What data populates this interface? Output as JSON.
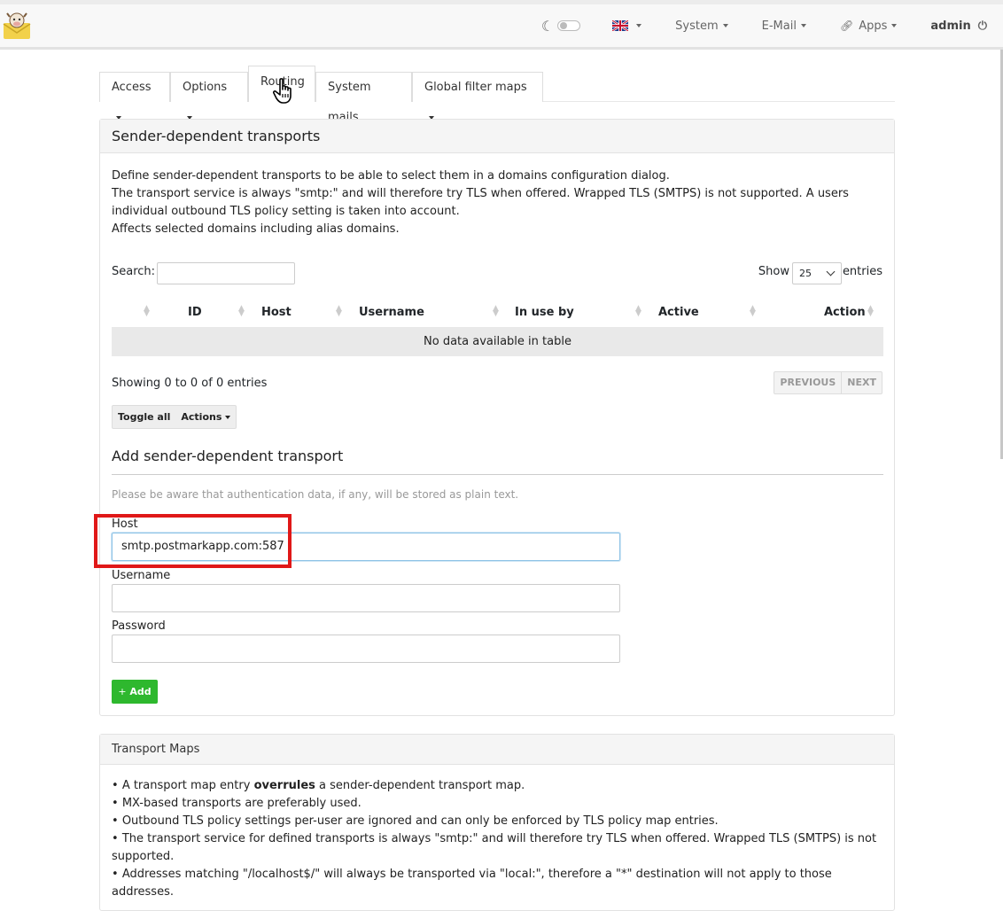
{
  "navbar": {
    "language_flag": "uk-flag-icon",
    "menus": [
      "System",
      "E-Mail",
      "Apps"
    ],
    "user": "admin"
  },
  "tabs": [
    {
      "label": "Access",
      "dropdown": true
    },
    {
      "label": "Options",
      "dropdown": true
    },
    {
      "label": "Routing",
      "active": true
    },
    {
      "label": "System mails"
    },
    {
      "label": "Global filter maps",
      "dropdown": true
    }
  ],
  "sender_panel": {
    "title": "Sender-dependent transports",
    "description": [
      "Define sender-dependent transports to be able to select them in a domains configuration dialog.",
      "The transport service is always \"smtp:\" and will therefore try TLS when offered. Wrapped TLS (SMTPS) is not supported. A users individual outbound TLS policy setting is taken into account.",
      "Affects selected domains including alias domains."
    ],
    "search_label": "Search:",
    "search_value": "",
    "show_label": "Show",
    "page_size": "25",
    "entries_label": "entries",
    "table": {
      "columns": [
        "ID",
        "Host",
        "Username",
        "In use by",
        "Active",
        "Action"
      ],
      "empty_message": "No data available in table"
    },
    "info": "Showing 0 to 0 of 0 entries",
    "pager": {
      "previous": "PREVIOUS",
      "next": "NEXT"
    },
    "bulk": {
      "toggle_all": "Toggle all",
      "actions": "Actions"
    },
    "add_section": {
      "title": "Add sender-dependent transport",
      "note": "Please be aware that authentication data, if any, will be stored as plain text.",
      "host_label": "Host",
      "host_value": "smtp.postmarkapp.com:587",
      "username_label": "Username",
      "username_value": "",
      "password_label": "Password",
      "password_value": "",
      "add_button": "Add",
      "add_button_icon": "+"
    }
  },
  "transport_panel": {
    "title": "Transport Maps",
    "bullets": [
      {
        "before": "A transport map entry ",
        "bold": "overrules",
        "after": " a sender-dependent transport map."
      },
      {
        "text": "MX-based transports are preferably used."
      },
      {
        "text": "Outbound TLS policy settings per-user are ignored and can only be enforced by TLS policy map entries."
      },
      {
        "text": "The transport service for defined transports is always \"smtp:\" and will therefore try TLS when offered. Wrapped TLS (SMTPS) is not supported."
      },
      {
        "text": "Addresses matching \"/localhost$/\" will always be transported via \"local:\", therefore a \"*\" destination will not apply to those addresses."
      }
    ]
  },
  "colors": {
    "add_button": "#2eb82e",
    "highlight": "#e01818",
    "empty_row": "#e9e9e9"
  }
}
